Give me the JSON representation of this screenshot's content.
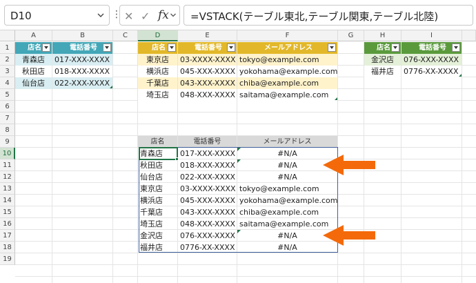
{
  "formula_bar": {
    "name_box": "D10",
    "formula": "=VSTACK(テーブル東北,テーブル関東,テーブル北陸)",
    "fx": "fx",
    "cancel_symbol": "✕",
    "enter_symbol": "✓"
  },
  "columns": [
    "A",
    "B",
    "C",
    "D",
    "E",
    "F",
    "G",
    "H",
    "I"
  ],
  "rows": [
    "1",
    "2",
    "3",
    "4",
    "5",
    "6",
    "7",
    "8",
    "9",
    "10",
    "11",
    "12",
    "13",
    "14",
    "15",
    "16",
    "17",
    "18",
    "19"
  ],
  "selected_cell": "D10",
  "colors": {
    "tohoku_header": "#43a7b7",
    "tohoku_band": "#d9eef2",
    "kanto_header": "#e2b82a",
    "kanto_band": "#fff3cc",
    "hokuriku_header": "#5a9a3c",
    "hokuriku_band": "#e4f0d8",
    "arrow": "#f46a0a",
    "spill_header_bg": "#d9d9d9"
  },
  "table_tohoku": {
    "headers": [
      "店名",
      "電話番号"
    ],
    "rows": [
      [
        "青森店",
        "017-XXX-XXXX"
      ],
      [
        "秋田店",
        "018-XXX-XXXX"
      ],
      [
        "仙台店",
        "022-XXX-XXXX"
      ]
    ]
  },
  "table_kanto": {
    "headers": [
      "店名",
      "電話番号",
      "メールアドレス"
    ],
    "rows": [
      [
        "東京店",
        "03-XXXX-XXXX",
        "tokyo@example.com"
      ],
      [
        "横浜店",
        "045-XXX-XXXX",
        "yokohama@example.com"
      ],
      [
        "千葉店",
        "043-XXX-XXXX",
        "chiba@example.com"
      ],
      [
        "埼玉店",
        "048-XXX-XXXX",
        "saitama@example.com"
      ]
    ]
  },
  "table_hokuriku": {
    "headers": [
      "店名",
      "電話番号"
    ],
    "rows": [
      [
        "金沢店",
        "076-XXX-XXXX"
      ],
      [
        "福井店",
        "0776-XX-XXXX"
      ]
    ]
  },
  "spill": {
    "headers": [
      "店名",
      "電話番号",
      "メールアドレス"
    ],
    "rows": [
      [
        "青森店",
        "017-XXX-XXXX",
        "#N/A"
      ],
      [
        "秋田店",
        "018-XXX-XXXX",
        "#N/A"
      ],
      [
        "仙台店",
        "022-XXX-XXXX",
        "#N/A"
      ],
      [
        "東京店",
        "03-XXXX-XXXX",
        "tokyo@example.com"
      ],
      [
        "横浜店",
        "045-XXX-XXXX",
        "yokohama@example.com"
      ],
      [
        "千葉店",
        "043-XXX-XXXX",
        "chiba@example.com"
      ],
      [
        "埼玉店",
        "048-XXX-XXXX",
        "saitama@example.com"
      ],
      [
        "金沢店",
        "076-XXX-XXXX",
        "#N/A"
      ],
      [
        "福井店",
        "0776-XX-XXXX",
        "#N/A"
      ]
    ]
  }
}
